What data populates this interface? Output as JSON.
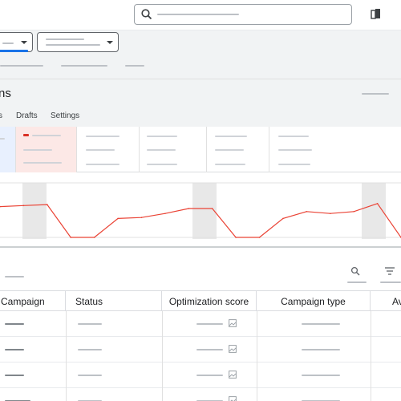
{
  "page": {
    "title_fragment": "ns",
    "tabs": [
      "s",
      "Drafts",
      "Settings"
    ]
  },
  "table": {
    "headers": [
      "Campaign",
      "Status",
      "Optimization score",
      "Campaign type",
      "Av"
    ],
    "row_count": 4
  },
  "colors": {
    "accent": "#1a73e8",
    "line_series": "#ea4335",
    "metric_negative": "#d93025",
    "header_bg": "#f1f3f4"
  },
  "chart_data": {
    "type": "line",
    "title": "",
    "xlabel": "",
    "ylabel": "",
    "ylim": [
      0,
      1
    ],
    "series": [
      {
        "values": [
          0.62,
          0.64,
          0.66,
          0.0,
          0.0,
          0.38,
          0.4,
          0.48,
          0.58,
          0.58,
          0.0,
          0.0,
          0.38,
          0.52,
          0.48,
          0.52,
          0.68,
          0.0
        ]
      }
    ],
    "shaded_bands": 3,
    "grid": true
  }
}
